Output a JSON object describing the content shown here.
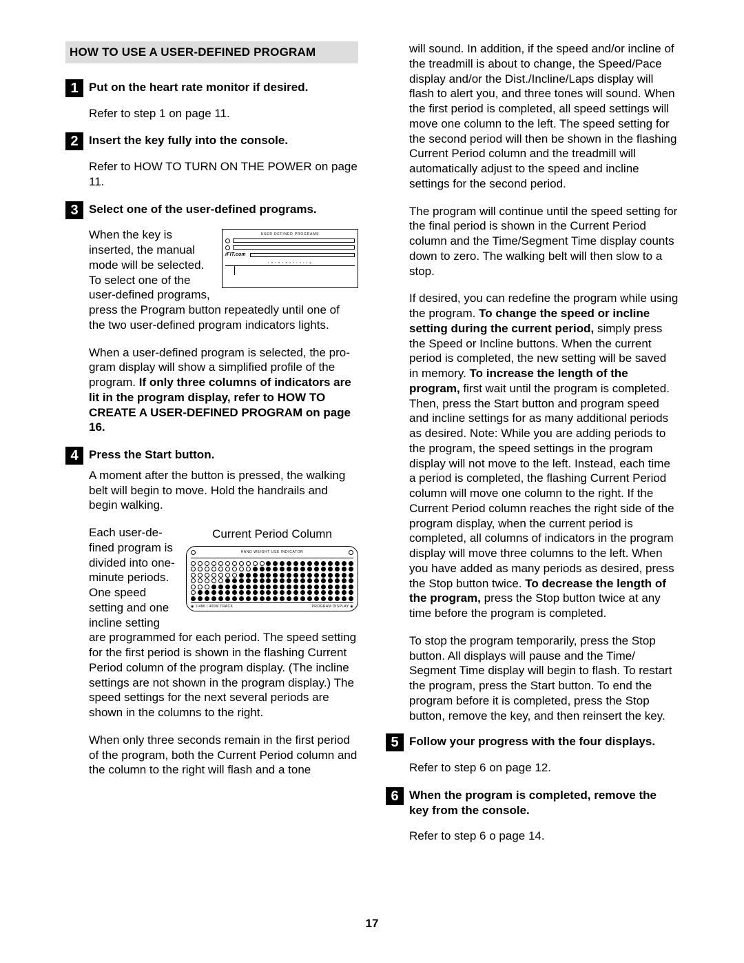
{
  "page_number": "17",
  "section_title": "HOW TO USE A USER-DEFINED PROGRAM",
  "steps": {
    "s1": {
      "num": "1",
      "head": "Put on the heart rate monitor if desired.",
      "body1": "Refer to step 1 on page 11."
    },
    "s2": {
      "num": "2",
      "head": "Insert the key fully into the console.",
      "body1": "Refer to HOW TO TURN ON THE POWER on page 11."
    },
    "s3": {
      "num": "3",
      "head": "Select one of the user-defined programs.",
      "p1a": "When the key is inserted, the manual mode will be selected. To select one of the user-defined pro­grams, press the",
      "p1b": "Program button repeatedly until one of the two user-defined program indicators lights.",
      "p2a": "When a user-defined program is selected, the pro­gram display will show a simplified profile of the program. ",
      "p2b": "If only three columns of indicators are lit in the program display, refer to HOW TO CREATE A USER-DEFINED PROGRAM on page 16.",
      "fig1_label": "USER DEFINED PROGRAMS",
      "fig1_ifit": "iFIT.com",
      "fig1_sub": "i  n  t  e  r  a  c  t  i  v  i  t  y"
    },
    "s4": {
      "num": "4",
      "head": "Press the Start button.",
      "p1": "A moment after the button is pressed, the walking belt will begin to move. Hold the handrails and begin walking.",
      "p2a": "Each user-de­fined program is divided into one-minute pe­riods. One speed setting and one incline setting are pro­grammed for each period. The speed set­",
      "p2b": "ting for the first period is shown in the flashing Current Period column of the program display. (The incline settings are not shown in the program display.) The speed settings for the next several periods are shown in the columns to the right.",
      "p3": "When only three seconds remain in the first period of the program, both the Current Period column and the column to the right will flash and a tone",
      "fig2_caption": "Current Period Column",
      "fig2_top": "HAND WEIGHT USE INDICATOR",
      "fig2_foot_left": "1/4MI / 400M TRACK",
      "fig2_foot_right": "PROGRAM DISPLAY"
    },
    "s5": {
      "num": "5",
      "head": "Follow your progress with the four displays.",
      "body1": "Refer to step 6 on page 12."
    },
    "s6": {
      "num": "6",
      "head": "When the program is completed, remove the key from the console.",
      "body1": "Refer to step 6 o page 14."
    }
  },
  "rcol": {
    "p1": "will sound. In addition, if the speed and/or incline of the treadmill is about to change, the Speed/Pace display and/or the Dist./Incline/Laps display will flash to alert you, and three tones will sound. When the first period is completed, all speed set­tings will move one column to the left. The speed setting for the second period will then be shown in the flashing Current Period column and the tread­mill will automatically adjust to the speed and in­cline settings for the second period.",
    "p2": "The program will continue until the speed setting for the final period is shown in the Current Period column and the Time/Segment Time display counts down to zero. The walking belt will then slow to a stop.",
    "p3a": "If desired, you can redefine the program while using the program. ",
    "p3b": "To change the speed or in­cline setting during the current period,",
    "p3c": " simply press the Speed or Incline buttons. When the current period is completed, the new setting will be saved in memory. ",
    "p3d": "To increase the length of the program,",
    "p3e": " first wait until the program is completed. Then, press the Start button and program speed and incline set­tings for as many additional periods as desired. Note: While you are adding periods to the pro­gram, the speed settings in the program display will not move to the left. Instead, each time a pe­riod is completed, the flashing Current Period col­umn will move one column to the right. If the Current Period column reaches the right side of the program display, when the current period is completed, all columns of indicators in the pro­gram display will move three columns to the left. When you have added as many periods as de­sired, press the Stop button twice. ",
    "p3f": "To decrease the length of the program,",
    "p3g": " press the Stop button twice at any time before the program is completed.",
    "p4": "To stop the program temporarily, press the Stop button. All displays will pause and the Time/ Segment Time display will begin to flash. To restart the program, press the Start button. To end the program before it is completed, press the Stop button, remove the key, and then reinsert the key."
  }
}
